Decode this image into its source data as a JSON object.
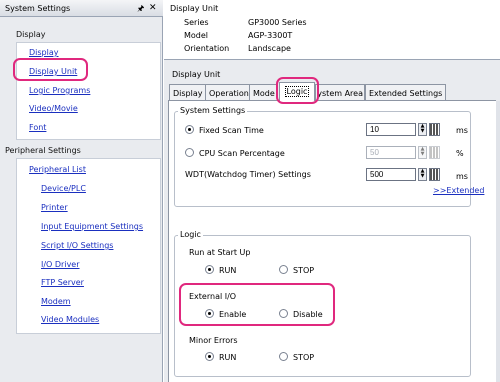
{
  "left_pane": {
    "title": "System Settings",
    "pin_icon": "pin",
    "close_icon": "x",
    "display_heading": "Display",
    "display_links": [
      "Display",
      "Display Unit",
      "Logic Programs",
      "Video/Movie",
      "Font"
    ],
    "peripheral_heading": "Peripheral Settings",
    "peripheral_list_label": "Peripheral List",
    "peripheral_links": [
      "Device/PLC",
      "Printer",
      "Input Equipment Settings",
      "Script I/O Settings",
      "I/O Driver",
      "FTP Server",
      "Modem",
      "Video Modules"
    ]
  },
  "info": {
    "title": "Display Unit",
    "series_label": "Series",
    "series_value": "GP3000 Series",
    "model_label": "Model",
    "model_value": "AGP-3300T",
    "orientation_label": "Orientation",
    "orientation_value": "Landscape"
  },
  "display_unit_title": "Display Unit",
  "tabs": [
    "Display",
    "Operation",
    "Mode",
    "Logic",
    "System Area",
    "Extended Settings"
  ],
  "active_tab": "Logic",
  "system_settings": {
    "label": "System Settings",
    "fixed_scan_label": "Fixed Scan Time",
    "fixed_scan_value": "10",
    "fixed_scan_unit": "ms",
    "cpu_label": "CPU Scan Percentage",
    "cpu_value": "50",
    "cpu_unit": "%",
    "wdt_label": "WDT(Watchdog Timer) Settings",
    "wdt_value": "500",
    "wdt_unit": "ms",
    "extended_link": ">>Extended"
  },
  "logic": {
    "label": "Logic",
    "run_at_startup_label": "Run at Start Up",
    "run_label": "RUN",
    "stop_label": "STOP",
    "external_io_label": "External I/O",
    "enable_label": "Enable",
    "disable_label": "Disable",
    "minor_errors_label": "Minor Errors",
    "minor_run_label": "RUN",
    "minor_stop_label": "STOP"
  },
  "colors": {
    "highlight": "#e0287e",
    "link": "#1a2fbf",
    "pane_bg": "#e9ebef"
  }
}
